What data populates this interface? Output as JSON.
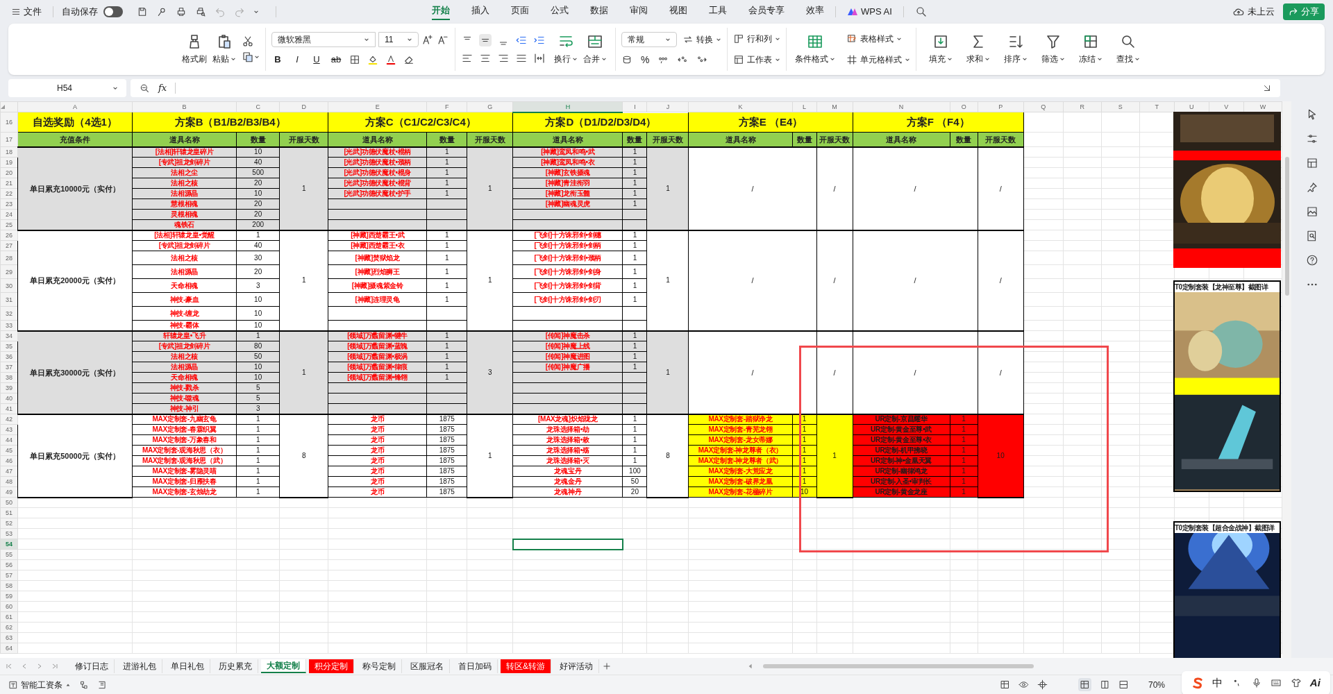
{
  "title_bar": {
    "menu": "文件",
    "autosave_label": "自动保存",
    "autosave_on": false,
    "tabs": [
      {
        "label": "开始",
        "selected": true
      },
      {
        "label": "插入",
        "selected": false
      },
      {
        "label": "页面",
        "selected": false
      },
      {
        "label": "公式",
        "selected": false
      },
      {
        "label": "数据",
        "selected": false
      },
      {
        "label": "审阅",
        "selected": false
      },
      {
        "label": "视图",
        "selected": false
      },
      {
        "label": "工具",
        "selected": false
      },
      {
        "label": "会员专享",
        "selected": false
      },
      {
        "label": "效率",
        "selected": false
      }
    ],
    "ai_label": "WPS AI",
    "cloud_label": "未上云",
    "share_label": "分享"
  },
  "ribbon": {
    "paint_format": "格式刷",
    "paste": "粘贴",
    "font_name": "微软雅黑",
    "font_size": "11",
    "text_styles": [
      "B",
      "I",
      "U",
      "ab"
    ],
    "wrap": "换行",
    "merge": "合并",
    "number_format": "常规",
    "convert": "转换",
    "percent": "%",
    "rows_cols": "行和列",
    "worksheet": "工作表",
    "conditional_format": "条件格式",
    "table_style": "表格样式",
    "cell_style": "单元格样式",
    "tools": [
      "填充",
      "求和",
      "排序",
      "筛选",
      "冻结",
      "查找"
    ]
  },
  "formula_bar": {
    "cell_ref": "H54",
    "fx": "fx"
  },
  "sheet": {
    "columns": [
      {
        "label": "A",
        "selected": false
      },
      {
        "label": "B",
        "selected": false
      },
      {
        "label": "C",
        "selected": false
      },
      {
        "label": "D",
        "selected": false
      },
      {
        "label": "E",
        "selected": false
      },
      {
        "label": "F",
        "selected": false
      },
      {
        "label": "G",
        "selected": false
      },
      {
        "label": "H",
        "selected": true
      },
      {
        "label": "I",
        "selected": false
      },
      {
        "label": "J",
        "selected": false
      },
      {
        "label": "K",
        "selected": false
      },
      {
        "label": "L",
        "selected": false
      },
      {
        "label": "M",
        "selected": false
      },
      {
        "label": "N",
        "selected": false
      },
      {
        "label": "O",
        "selected": false
      },
      {
        "label": "P",
        "selected": false
      },
      {
        "label": "Q",
        "selected": false
      },
      {
        "label": "R",
        "selected": false
      },
      {
        "label": "S",
        "selected": false
      },
      {
        "label": "T",
        "selected": false
      },
      {
        "label": "U",
        "selected": false
      },
      {
        "label": "V",
        "selected": false
      },
      {
        "label": "W",
        "selected": false
      }
    ],
    "rows": [
      {
        "label": "16",
        "selected": false
      },
      {
        "label": "17",
        "selected": false
      },
      {
        "label": "18",
        "selected": false
      },
      {
        "label": "19",
        "selected": false
      },
      {
        "label": "20",
        "selected": false
      },
      {
        "label": "21",
        "selected": false
      },
      {
        "label": "22",
        "selected": false
      },
      {
        "label": "23",
        "selected": false
      },
      {
        "label": "24",
        "selected": false
      },
      {
        "label": "25",
        "selected": false
      },
      {
        "label": "26",
        "selected": false
      },
      {
        "label": "27",
        "selected": false
      },
      {
        "label": "28",
        "selected": false
      },
      {
        "label": "29",
        "selected": false
      },
      {
        "label": "30",
        "selected": false
      },
      {
        "label": "31",
        "selected": false
      },
      {
        "label": "32",
        "selected": false
      },
      {
        "label": "33",
        "selected": false
      },
      {
        "label": "34",
        "selected": false
      },
      {
        "label": "35",
        "selected": false
      },
      {
        "label": "36",
        "selected": false
      },
      {
        "label": "37",
        "selected": false
      },
      {
        "label": "38",
        "selected": false
      },
      {
        "label": "39",
        "selected": false
      },
      {
        "label": "40",
        "selected": false
      },
      {
        "label": "41",
        "selected": false
      },
      {
        "label": "42",
        "selected": false
      },
      {
        "label": "43",
        "selected": false
      },
      {
        "label": "44",
        "selected": false
      },
      {
        "label": "45",
        "selected": false
      },
      {
        "label": "46",
        "selected": false
      },
      {
        "label": "47",
        "selected": false
      },
      {
        "label": "48",
        "selected": false
      },
      {
        "label": "49",
        "selected": false
      },
      {
        "label": "50",
        "selected": false
      },
      {
        "label": "51",
        "selected": false
      },
      {
        "label": "52",
        "selected": false
      },
      {
        "label": "53",
        "selected": false
      },
      {
        "label": "54",
        "selected": true
      },
      {
        "label": "55",
        "selected": false
      },
      {
        "label": "56",
        "selected": false
      },
      {
        "label": "57",
        "selected": false
      },
      {
        "label": "58",
        "selected": false
      },
      {
        "label": "59",
        "selected": false
      },
      {
        "label": "60",
        "selected": false
      },
      {
        "label": "61",
        "selected": false
      },
      {
        "label": "62",
        "selected": false
      },
      {
        "label": "63",
        "selected": false
      },
      {
        "label": "64",
        "selected": false
      }
    ]
  },
  "table": {
    "title_row": [
      "自选奖励（4选1）",
      "方案B（B1/B2/B3/B4）",
      "方案C（C1/C2/C3/C4）",
      "方案D（D1/D2/D3/D4）",
      "方案E （E4）",
      "方案F （F4）"
    ],
    "header_row": [
      "充值条件",
      "道具名称",
      "数量",
      "开服天数",
      "道具名称",
      "数量",
      "开服天数",
      "道具名称",
      "数量",
      "开服天数",
      "道具名称",
      "数量",
      "开服天数",
      "道具名称",
      "数量",
      "开服天数"
    ],
    "groups": [
      {
        "condition": "单日累充10000元（实付）",
        "shaded": true,
        "plans": [
          {
            "kind": "items",
            "days": "1",
            "items": [
              {
                "name": "[法相]轩辕龙皇碎片",
                "qty": "10"
              },
              {
                "name": "[专武]祖龙剑碎片",
                "qty": "40"
              },
              {
                "name": "法相之尘",
                "qty": "500"
              },
              {
                "name": "法相之核",
                "qty": "20"
              },
              {
                "name": "法相源晶",
                "qty": "10"
              },
              {
                "name": "慧根相魂",
                "qty": "20"
              },
              {
                "name": "灵根相魂",
                "qty": "20"
              },
              {
                "name": "魂铁石",
                "qty": "200"
              }
            ]
          },
          {
            "kind": "items",
            "days": "1",
            "items": [
              {
                "name": "[光武]功德伏魔杖•棍柄",
                "qty": "1"
              },
              {
                "name": "[光武]功德伏魔杖•颈柄",
                "qty": "1"
              },
              {
                "name": "[光武]功德伏魔杖•棍身",
                "qty": "1"
              },
              {
                "name": "[光武]功德伏魔杖•棍背",
                "qty": "1"
              },
              {
                "name": "[光武]功德伏魔杖•护手",
                "qty": "1"
              }
            ]
          },
          {
            "kind": "items",
            "days": "1",
            "items": [
              {
                "name": "[神藏]鸾凤和鸣•武",
                "qty": "1"
              },
              {
                "name": "[神藏]鸾凤和鸣•衣",
                "qty": "1"
              },
              {
                "name": "[神藏]玄铁摄魂",
                "qty": "1"
              },
              {
                "name": "[神藏]青洼衔羽",
                "qty": "1"
              },
              {
                "name": "[神藏]龙衔玉髓",
                "qty": "1"
              },
              {
                "name": "[神藏]幽魂灵虎",
                "qty": "1"
              }
            ]
          },
          {
            "kind": "none",
            "cells": [
              "/",
              "/"
            ]
          },
          {
            "kind": "none",
            "cells": [
              "/",
              "/"
            ]
          }
        ]
      },
      {
        "condition": "单日累充20000元（实付）",
        "shaded": false,
        "plans": [
          {
            "kind": "items",
            "days": "1",
            "items": [
              {
                "name": "[法相]轩辕龙皇•觉醒",
                "qty": "1"
              },
              {
                "name": "[专武]祖龙剑碎片",
                "qty": "40"
              },
              {
                "name": "法相之核",
                "qty": "30"
              },
              {
                "name": "法相源晶",
                "qty": "20"
              },
              {
                "name": "天命相魂",
                "qty": "3"
              },
              {
                "name": "神技-豪血",
                "qty": "10"
              },
              {
                "name": "神技-缠龙",
                "qty": "10"
              },
              {
                "name": "神技-霸体",
                "qty": "10"
              }
            ]
          },
          {
            "kind": "items",
            "days": "1",
            "items": [
              {
                "name": "[神藏]西楚霸王•武",
                "qty": "1"
              },
              {
                "name": "[神藏]西楚霸王•衣",
                "qty": "1"
              },
              {
                "name": "[神藏]焚狱焰龙",
                "qty": "1"
              },
              {
                "name": "[神藏]烈焰狮王",
                "qty": "1"
              },
              {
                "name": "[神藏]摄魂紫金铃",
                "qty": "1"
              },
              {
                "name": "[神藏]连理灵龟",
                "qty": "1"
              }
            ]
          },
          {
            "kind": "items",
            "days": "1",
            "items": [
              {
                "name": "[飞剑]十方诛邪剑•剑穗",
                "qty": "1"
              },
              {
                "name": "[飞剑]十方诛邪剑•剑柄",
                "qty": "1"
              },
              {
                "name": "[飞剑]十方诛邪剑•颈柄",
                "qty": "1"
              },
              {
                "name": "[飞剑]十方诛邪剑•剑身",
                "qty": "1"
              },
              {
                "name": "[飞剑]十方诛邪剑•剑背",
                "qty": "1"
              },
              {
                "name": "[飞剑]十方诛邪剑•剑刃",
                "qty": "1"
              }
            ]
          },
          {
            "kind": "none",
            "cells": [
              "/",
              "/"
            ]
          },
          {
            "kind": "none",
            "cells": [
              "/",
              "/"
            ]
          }
        ]
      },
      {
        "condition": "单日累充30000元（实付）",
        "shaded": true,
        "plans": [
          {
            "kind": "items",
            "days": "1",
            "items": [
              {
                "name": "轩辕龙皇•飞升",
                "qty": "1"
              },
              {
                "name": "[专武]祖龙剑碎片",
                "qty": "80"
              },
              {
                "name": "法相之核",
                "qty": "50"
              },
              {
                "name": "法相源晶",
                "qty": "10"
              },
              {
                "name": "天命相魂",
                "qty": "10"
              },
              {
                "name": "神技-戮杀",
                "qty": "5"
              },
              {
                "name": "神技-噬魂",
                "qty": "5"
              },
              {
                "name": "神技-神引",
                "qty": "3"
              }
            ]
          },
          {
            "kind": "items",
            "days": "3",
            "items": [
              {
                "name": "[领域]万蠡留渊•犍牛",
                "qty": "1"
              },
              {
                "name": "[领域]万蠡留渊•蓝魄",
                "qty": "1"
              },
              {
                "name": "[领域]万蠡留渊•极涡",
                "qty": "1"
              },
              {
                "name": "[领域]万蠡留渊•律痕",
                "qty": "1"
              },
              {
                "name": "[领域]万蠡留渊•锋翎",
                "qty": "1"
              }
            ]
          },
          {
            "kind": "items",
            "days": "1",
            "items": [
              {
                "name": "[传闻]神魔击杀",
                "qty": "1"
              },
              {
                "name": "[传闻]神魔上线",
                "qty": "1"
              },
              {
                "name": "[传闻]神魔进图",
                "qty": "1"
              },
              {
                "name": "[传闻]神魔广播",
                "qty": "1"
              }
            ]
          },
          {
            "kind": "none",
            "cells": [
              "/",
              "/"
            ]
          },
          {
            "kind": "none",
            "cells": [
              "/",
              "/"
            ]
          }
        ]
      },
      {
        "condition": "单日累充50000元（实付）",
        "shaded": false,
        "plans": [
          {
            "kind": "items",
            "days": "8",
            "items": [
              {
                "name": "MAX定制套-九幽玄龟",
                "qty": "1"
              },
              {
                "name": "MAX定制套-春霖织翼",
                "qty": "1"
              },
              {
                "name": "MAX定制套-万象春和",
                "qty": "1"
              },
              {
                "name": "MAX定制套-观海秋思（衣）",
                "qty": "1"
              },
              {
                "name": "MAX定制套-观海秋思（武）",
                "qty": "1"
              },
              {
                "name": "MAX定制套-雾隐灵喵",
                "qty": "1"
              },
              {
                "name": "MAX定制套-归雁扶春",
                "qty": "1"
              },
              {
                "name": "MAX定制套-玄烛劫龙",
                "qty": "1"
              }
            ]
          },
          {
            "kind": "items",
            "days": "1",
            "items": [
              {
                "name": "龙币",
                "qty": "1875"
              },
              {
                "name": "龙币",
                "qty": "1875"
              },
              {
                "name": "龙币",
                "qty": "1875"
              },
              {
                "name": "龙币",
                "qty": "1875"
              },
              {
                "name": "龙币",
                "qty": "1875"
              },
              {
                "name": "龙币",
                "qty": "1875"
              },
              {
                "name": "龙币",
                "qty": "1875"
              },
              {
                "name": "龙币",
                "qty": "1875"
              }
            ]
          },
          {
            "kind": "items",
            "days": "8",
            "items": [
              {
                "name": "[MAX龙魂]炽焰珑龙",
                "qty": "1"
              },
              {
                "name": "龙珠选择箱•劫",
                "qty": "1"
              },
              {
                "name": "龙珠选择箱•敕",
                "qty": "1"
              },
              {
                "name": "龙珠选择箱•殇",
                "qty": "1"
              },
              {
                "name": "龙珠选择箱•灭",
                "qty": "1"
              },
              {
                "name": "龙魂宝丹",
                "qty": "100"
              },
              {
                "name": "龙魂金丹",
                "qty": "50"
              },
              {
                "name": "龙魂神丹",
                "qty": "20"
              }
            ]
          },
          {
            "kind": "items",
            "days": "1",
            "color": "#ffff00",
            "items": [
              {
                "name": "MAX定制套-踏狱诤龙",
                "qty": "1"
              },
              {
                "name": "MAX定制套-青芜龙翎",
                "qty": "1"
              },
              {
                "name": "MAX定制套-龙女蒂娜",
                "qty": "1"
              },
              {
                "name": "MAX定制套-神龙尊者（衣）",
                "qty": "1"
              },
              {
                "name": "MAX定制套-神龙尊者（武）",
                "qty": "1"
              },
              {
                "name": "MAX定制套-大荒应龙",
                "qty": "1"
              },
              {
                "name": "MAX定制套-破界龙凰",
                "qty": "1"
              },
              {
                "name": "MAX定制套-花楹碎片",
                "qty": "10"
              }
            ]
          },
          {
            "kind": "items",
            "days": "10",
            "color": "#ff0000",
            "items": [
              {
                "name": "UR定制-京昌耀华",
                "qty": "1"
              },
              {
                "name": "UR定制-黄金至尊•武",
                "qty": "1"
              },
              {
                "name": "UR定制-黄金至尊•衣",
                "qty": "1"
              },
              {
                "name": "UR定制-机甲拂晓",
                "qty": "1"
              },
              {
                "name": "UR定制-神•金凰天翼",
                "qty": "1"
              },
              {
                "name": "UR定制-幽律鸿龙",
                "qty": "1"
              },
              {
                "name": "UR定制-入圣•审判长",
                "qty": "1"
              },
              {
                "name": "UR定制-黄金龙座",
                "qty": "1"
              }
            ]
          }
        ]
      }
    ]
  },
  "side_images": [
    {
      "kind": "picture"
    },
    {
      "kind": "captioned",
      "caption": "T0定制套装【龙神至尊】截图详"
    },
    {
      "kind": "captioned",
      "caption": "T0定制套装【超合金战神】截图详"
    }
  ],
  "sheet_tabs": [
    {
      "label": "修订日志",
      "selected": false
    },
    {
      "label": "进游礼包",
      "selected": false
    },
    {
      "label": "单日礼包",
      "selected": false
    },
    {
      "label": "历史累充",
      "selected": false
    },
    {
      "label": "大额定制",
      "selected": true
    },
    {
      "label": "积分定制",
      "selected": false,
      "color": "#ff0000"
    },
    {
      "label": "称号定制",
      "selected": false
    },
    {
      "label": "区服冠名",
      "selected": false
    },
    {
      "label": "首日加码",
      "selected": false
    },
    {
      "label": "转区&转游",
      "selected": false,
      "color": "#ff0000"
    },
    {
      "label": "好评活动",
      "selected": false
    }
  ],
  "status_bar": {
    "payroll": "智能工资条",
    "zoom": "70%",
    "ime": [
      "中",
      "Ai"
    ]
  }
}
